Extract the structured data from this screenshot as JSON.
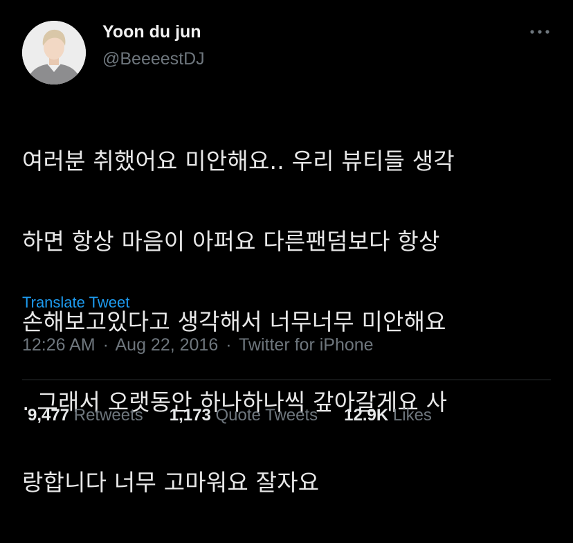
{
  "header": {
    "display_name": "Yoon du jun",
    "handle": "@BeeeestDJ",
    "avatar_icon": "profile-photo",
    "more_icon": "ellipsis-icon"
  },
  "tweet": {
    "lines": [
      "여러분 취했어요 미안해요.. 우리 뷰티들 생각",
      "하면 항상 마음이 아퍼요 다른팬덤보다 항상",
      "손해보고있다고 생각해서 너무너무 미안해요",
      ". 그래서 오랫동안 하나하나씩 갚아갈게요 사",
      "랑합니다 너무 고마워요 잘자요"
    ],
    "translate_label": "Translate Tweet"
  },
  "meta": {
    "time": "12:26 AM",
    "separator": "·",
    "date": "Aug 22, 2016",
    "source": "Twitter for iPhone"
  },
  "stats": {
    "retweets_count": "9,477",
    "retweets_label": "Retweets",
    "quotes_count": "1,173",
    "quotes_label": "Quote Tweets",
    "likes_count": "12.9K",
    "likes_label": "Likes"
  },
  "colors": {
    "background": "#000000",
    "link": "#1d9bf0",
    "secondary_text": "#6e767d",
    "primary_text": "#e7e9ea",
    "divider": "#2f3336"
  }
}
